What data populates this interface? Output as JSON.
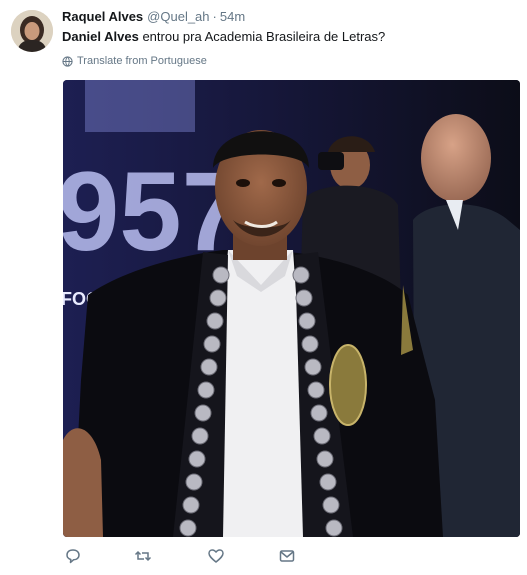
{
  "tweet": {
    "author_name": "Raquel Alves",
    "handle": "@Quel_ah",
    "separator": "·",
    "time": "54m",
    "mention": "Daniel Alves",
    "body": " entrou pra Academia Brasileira de Letras?",
    "translate_label": "Translate from Portuguese"
  },
  "media": {
    "backdrop_text": "FOOTBAL",
    "backdrop_numbers": "957"
  },
  "icons": {
    "reply": "speech-bubble-icon",
    "retweet": "retweet-arrows-icon",
    "like": "heart-icon",
    "dm": "envelope-icon",
    "translate": "globe-icon"
  },
  "colors": {
    "text": "#14171a",
    "secondary": "#657786",
    "backdrop": "#141633"
  }
}
